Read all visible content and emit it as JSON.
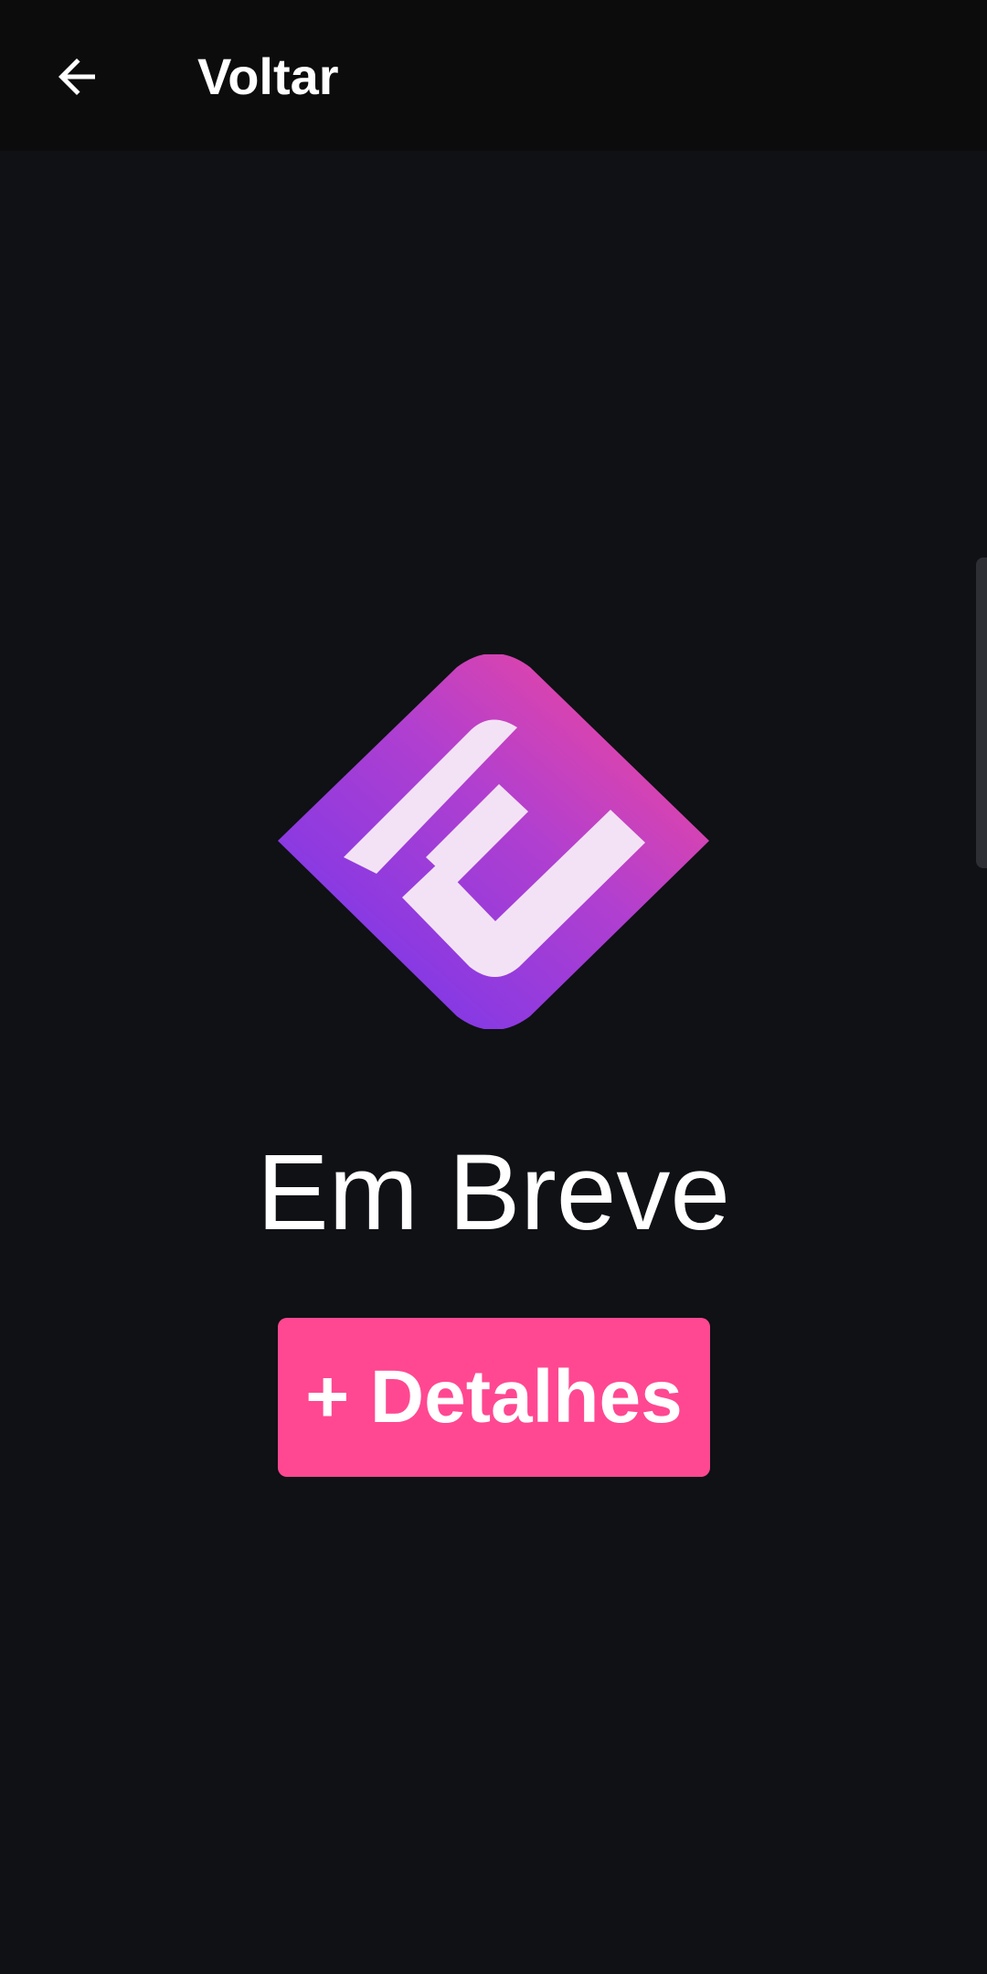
{
  "header": {
    "back_icon": "arrow-left-icon",
    "title": "Voltar"
  },
  "main": {
    "logo_icon": "app-logo-icon",
    "headline": "Em Breve",
    "details_button_label": "+ Detalhes"
  },
  "colors": {
    "background": "#0f1115",
    "top_bar": "#0c0c0d",
    "accent_pink": "#ff4891",
    "logo_gradient_start": "#6b35f0",
    "logo_gradient_end": "#ff4891",
    "text": "#ffffff"
  }
}
